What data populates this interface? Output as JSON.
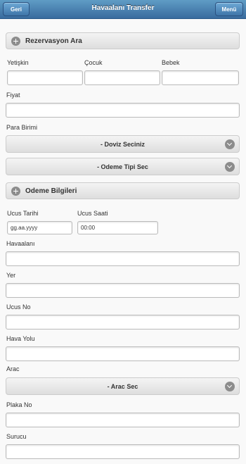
{
  "header": {
    "back": "Geri",
    "title": "Havaalanı Transfer",
    "menu": "Menü"
  },
  "reservation": {
    "heading": "Rezervasyon Ara",
    "adult_label": "Yetişkin",
    "child_label": "Çocuk",
    "baby_label": "Bebek",
    "price_label": "Fiyat",
    "currency_label": "Para Birimi",
    "currency_select": "- Doviz Seciniz",
    "payment_select": "- Odeme Tipi Sec"
  },
  "payment": {
    "heading": "Odeme Bilgileri",
    "flight_date_label": "Ucus Tarihi",
    "flight_date_value": "gg.aa.yyyy",
    "flight_time_label": "Ucus Saati",
    "flight_time_value": "00:00",
    "airport_label": "Havaalanı",
    "place_label": "Yer",
    "flight_no_label": "Ucus No",
    "airline_label": "Hava Yolu",
    "vehicle_label": "Arac",
    "vehicle_select": "- Arac Sec",
    "plate_label": "Plaka No",
    "driver_label": "Surucu"
  },
  "icons": {
    "expand": "plus-circle-icon",
    "dropdown": "chevron-down-icon"
  },
  "colors": {
    "header": "#396b9e",
    "accent": "#5f9cc5"
  }
}
